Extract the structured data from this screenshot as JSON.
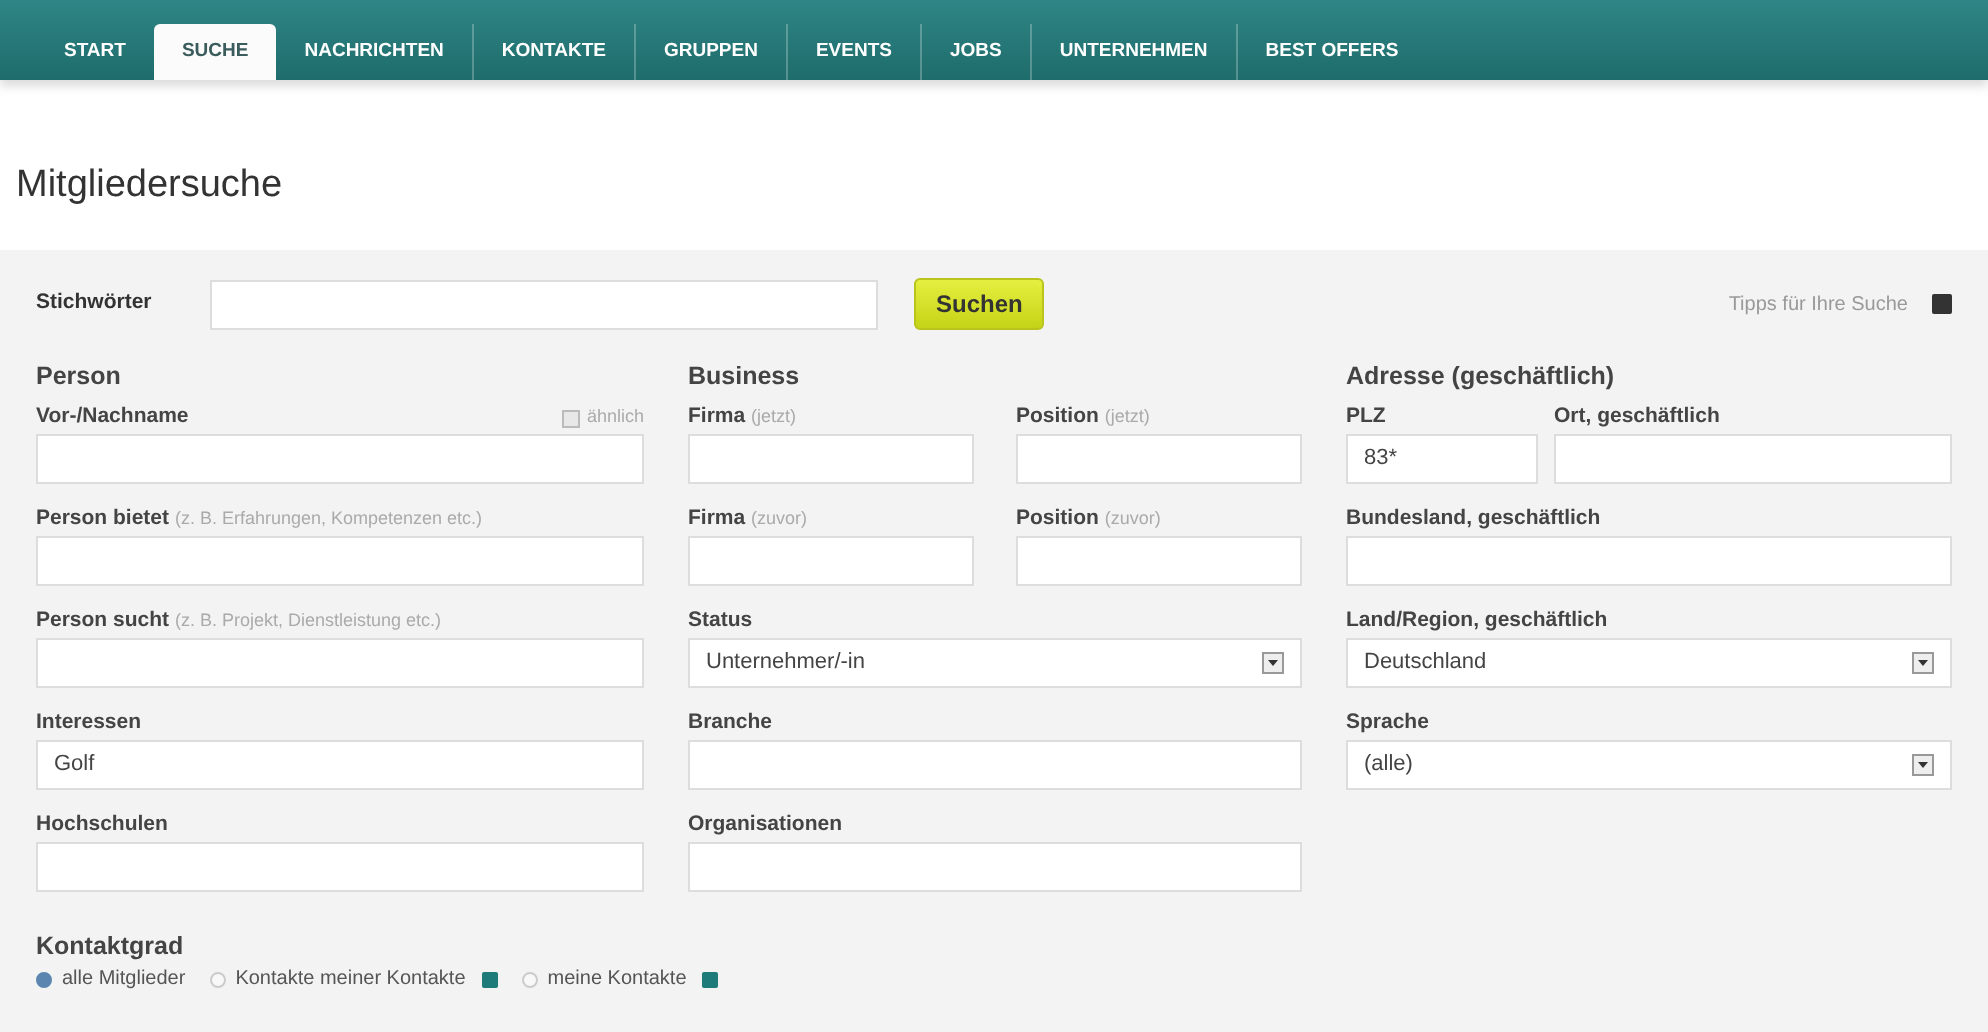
{
  "nav": {
    "tabs": [
      {
        "label": "START",
        "selected": false
      },
      {
        "label": "SUCHE",
        "selected": true
      },
      {
        "label": "NACHRICHTEN",
        "selected": false
      },
      {
        "label": "KONTAKTE",
        "selected": false
      },
      {
        "label": "GRUPPEN",
        "selected": false
      },
      {
        "label": "EVENTS",
        "selected": false
      },
      {
        "label": "JOBS",
        "selected": false
      },
      {
        "label": "UNTERNEHMEN",
        "selected": false
      },
      {
        "label": "BEST OFFERS",
        "selected": false
      }
    ]
  },
  "page_title": "Mitgliedersuche",
  "keyword": {
    "label": "Stichwörter",
    "button": "Suchen",
    "tips": "Tipps für Ihre Suche"
  },
  "columns": [
    {
      "heading": "Person",
      "rows": [
        [
          {
            "kind": "text",
            "label": "Vor-/Nachname",
            "similar": {
              "label": "ähnlich",
              "checked": false
            }
          }
        ],
        [
          {
            "kind": "text",
            "label": "Person bietet",
            "hint": "(z. B. Erfahrungen, Kompetenzen etc.)"
          }
        ],
        [
          {
            "kind": "text",
            "label": "Person sucht",
            "hint": "(z. B. Projekt, Dienstleistung etc.)"
          }
        ],
        [
          {
            "kind": "text",
            "label": "Interessen",
            "value": "Golf"
          }
        ],
        [
          {
            "kind": "text",
            "label": "Hochschulen"
          }
        ]
      ]
    },
    {
      "heading": "Business",
      "rows": [
        [
          {
            "kind": "text",
            "label": "Firma",
            "hint": "(jetzt)"
          },
          {
            "kind": "text",
            "label": "Position",
            "hint": "(jetzt)"
          }
        ],
        [
          {
            "kind": "text",
            "label": "Firma",
            "hint": "(zuvor)"
          },
          {
            "kind": "text",
            "label": "Position",
            "hint": "(zuvor)"
          }
        ],
        [
          {
            "kind": "select",
            "label": "Status",
            "value": "Unternehmer/-in"
          }
        ],
        [
          {
            "kind": "text",
            "label": "Branche"
          }
        ],
        [
          {
            "kind": "text",
            "label": "Organisationen"
          }
        ]
      ]
    },
    {
      "heading": "Adresse (geschäftlich)",
      "rows": [
        [
          {
            "kind": "text",
            "label": "PLZ",
            "value": "83*"
          },
          {
            "kind": "text",
            "label": "Ort, geschäftlich"
          }
        ],
        [
          {
            "kind": "text",
            "label": "Bundesland, geschäftlich"
          }
        ],
        [
          {
            "kind": "select",
            "label": "Land/Region, geschäftlich",
            "value": "Deutschland"
          }
        ],
        [
          {
            "kind": "select",
            "label": "Sprache",
            "value": "(alle)"
          }
        ]
      ]
    }
  ],
  "contact_degree": {
    "heading": "Kontaktgrad",
    "options": [
      {
        "label": "alle Mitglieder",
        "selected": true,
        "info": false
      },
      {
        "label": "Kontakte meiner Kontakte",
        "selected": false,
        "info": true
      },
      {
        "label": "meine Kontakte",
        "selected": false,
        "info": true
      }
    ]
  }
}
